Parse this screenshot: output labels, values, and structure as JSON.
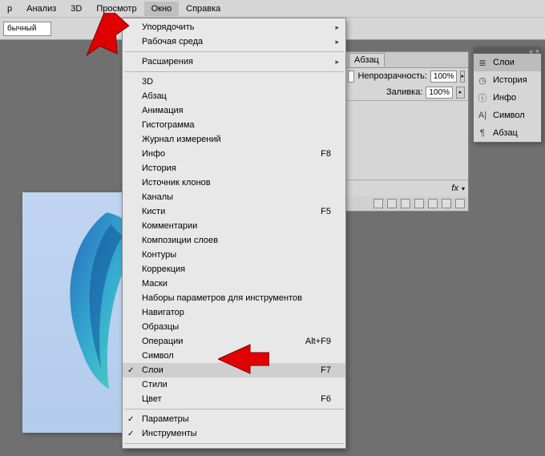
{
  "menubar": {
    "items": [
      {
        "label": "р"
      },
      {
        "label": "Анализ"
      },
      {
        "label": "3D"
      },
      {
        "label": "Просмотр"
      },
      {
        "label": "Окно",
        "open": true
      },
      {
        "label": "Справка"
      }
    ]
  },
  "toolbar2": {
    "mode_label": "бычный"
  },
  "window_menu": {
    "group1": [
      {
        "label": "Упорядочить",
        "submenu": true
      },
      {
        "label": "Рабочая среда",
        "submenu": true
      }
    ],
    "group2": [
      {
        "label": "Расширения",
        "submenu": true
      }
    ],
    "group3": [
      {
        "label": "3D"
      },
      {
        "label": "Абзац"
      },
      {
        "label": "Анимация"
      },
      {
        "label": "Гистограмма"
      },
      {
        "label": "Журнал измерений"
      },
      {
        "label": "Инфо",
        "shortcut": "F8"
      },
      {
        "label": "История"
      },
      {
        "label": "Источник клонов"
      },
      {
        "label": "Каналы"
      },
      {
        "label": "Кисти",
        "shortcut": "F5"
      },
      {
        "label": "Комментарии"
      },
      {
        "label": "Композиции слоев"
      },
      {
        "label": "Контуры"
      },
      {
        "label": "Коррекция"
      },
      {
        "label": "Маски"
      },
      {
        "label": "Наборы параметров для инструментов"
      },
      {
        "label": "Навигатор"
      },
      {
        "label": "Образцы"
      },
      {
        "label": "Операции",
        "shortcut": "Alt+F9"
      },
      {
        "label": "Символ"
      },
      {
        "label": "Слои",
        "shortcut": "F7",
        "checked": true,
        "highlight": true
      },
      {
        "label": "Стили"
      },
      {
        "label": "Цвет",
        "shortcut": "F6"
      }
    ],
    "group4": [
      {
        "label": "Параметры",
        "checked": true
      },
      {
        "label": "Инструменты",
        "checked": true
      }
    ]
  },
  "layers_panel": {
    "tab": "Абзац",
    "visible_select": "",
    "opacity_label": "Непрозрачность:",
    "opacity_value": "100%",
    "fill_label": "Заливка:",
    "fill_value": "100%",
    "fx_label": "fx"
  },
  "side_panel": {
    "items": [
      {
        "icon": "layers-icon",
        "glyph": "≣",
        "label": "Слои",
        "active": true
      },
      {
        "icon": "history-icon",
        "glyph": "◷",
        "label": "История"
      },
      {
        "icon": "info-icon",
        "glyph": "ⓘ",
        "label": "Инфо"
      },
      {
        "icon": "character-icon",
        "glyph": "A|",
        "label": "Символ"
      },
      {
        "icon": "paragraph-icon",
        "glyph": "¶",
        "label": "Абзац"
      }
    ]
  }
}
